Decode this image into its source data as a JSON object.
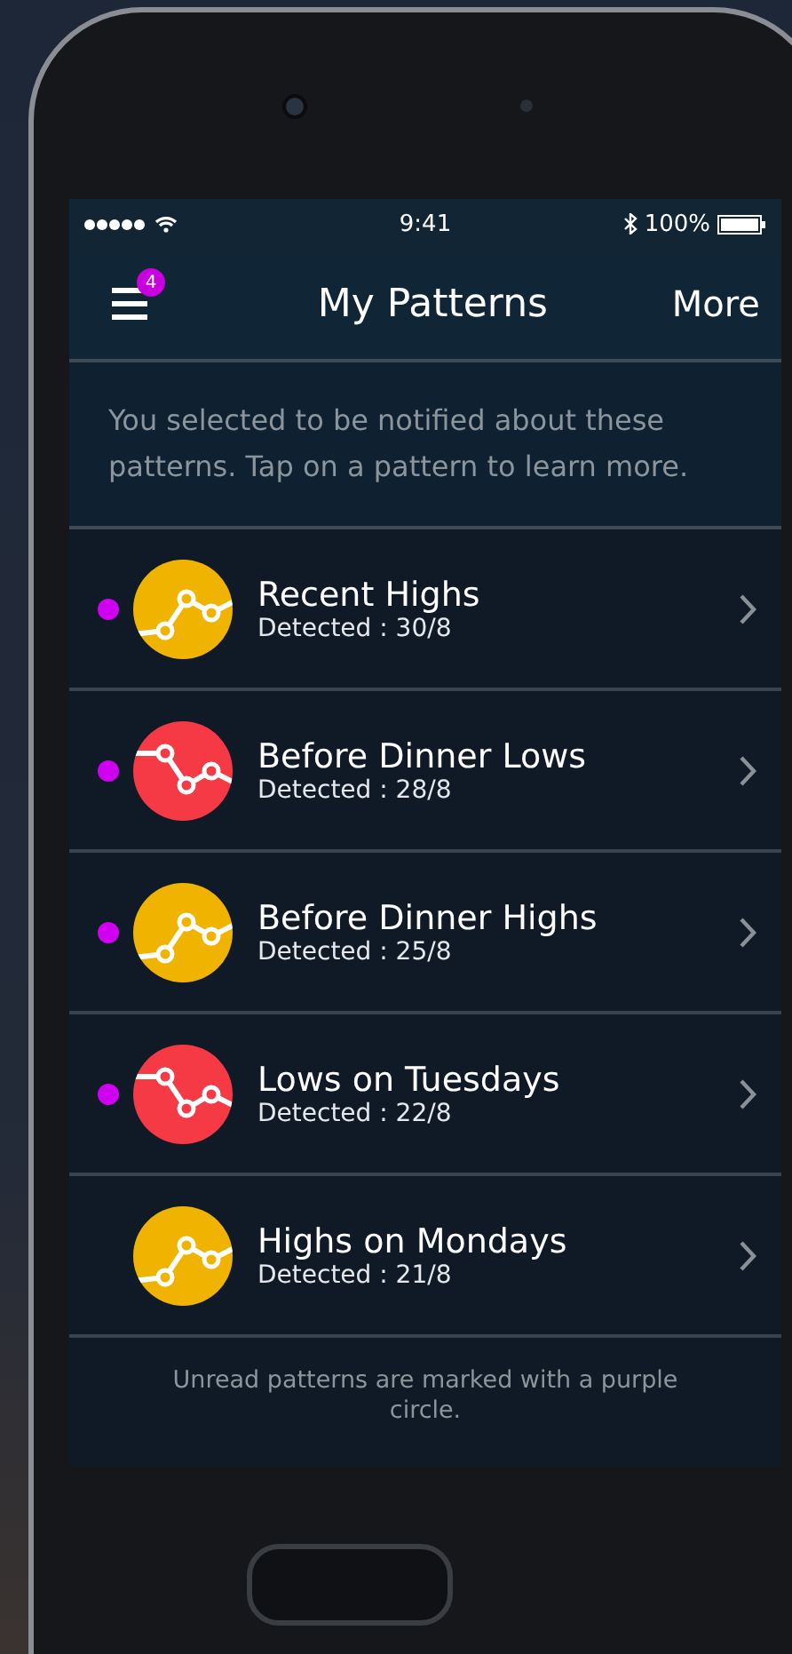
{
  "status_bar": {
    "time": "9:41",
    "battery": "100%"
  },
  "nav": {
    "badge": "4",
    "title": "My Patterns",
    "action": "More"
  },
  "intro": "You selected to be notified about these patterns. Tap on a pattern to learn more.",
  "patterns": [
    {
      "title": "Recent Highs",
      "detected": "Detected : 30/8",
      "kind": "high",
      "unread": true
    },
    {
      "title": "Before Dinner Lows",
      "detected": "Detected : 28/8",
      "kind": "low",
      "unread": true
    },
    {
      "title": "Before Dinner Highs",
      "detected": "Detected : 25/8",
      "kind": "high",
      "unread": true
    },
    {
      "title": "Lows on Tuesdays",
      "detected": "Detected : 22/8",
      "kind": "low",
      "unread": true
    },
    {
      "title": "Highs on Mondays",
      "detected": "Detected : 21/8",
      "kind": "high",
      "unread": false
    }
  ],
  "footer": "Unread patterns are marked with a purple circle."
}
